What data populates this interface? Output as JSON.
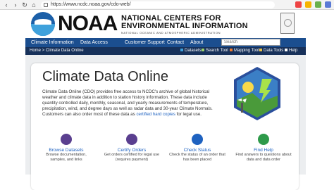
{
  "browser": {
    "url": "https://www.ncdc.noaa.gov/cdo-web/"
  },
  "header": {
    "brand": "NOAA",
    "center_name_line1": "NATIONAL CENTERS FOR",
    "center_name_line2": "ENVIRONMENTAL INFORMATION",
    "center_sub": "NATIONAL OCEANIC AND ATMOSPHERIC ADMINISTRATION"
  },
  "menu": {
    "items": [
      "Climate Information",
      "Data Access",
      "Customer Support",
      "Contact",
      "About"
    ],
    "search_placeholder": "Search"
  },
  "subbar": {
    "breadcrumb": "Home > Climate Data Online",
    "tools": [
      "Datasets",
      "Search Tool",
      "Mapping Tool",
      "Data Tools",
      "Help"
    ]
  },
  "main": {
    "title": "Climate Data Online",
    "desc1": "Climate Data Online (CDO) provides free access to NCDC's archive of global historical weather and climate data in addition to station history information. These data include quantity controlled daily, monthly, seasonal, and yearly measurements of temperature, precipitation, wind, and degree days as well as radar data and 30-year Climate Normals. Customers can also order most of these data as ",
    "desc_link": "certified hard copies",
    "desc2": " for legal use."
  },
  "links": [
    {
      "title": "Browse Datasets",
      "desc": "Browse documentation, samples, and links"
    },
    {
      "title": "Certify Orders",
      "desc": "Get orders certified for legal use (requires payment)"
    },
    {
      "title": "Check Status",
      "desc": "Check the status of an order that has been placed"
    },
    {
      "title": "Find Help",
      "desc": "Find answers to questions about data and data order"
    }
  ]
}
